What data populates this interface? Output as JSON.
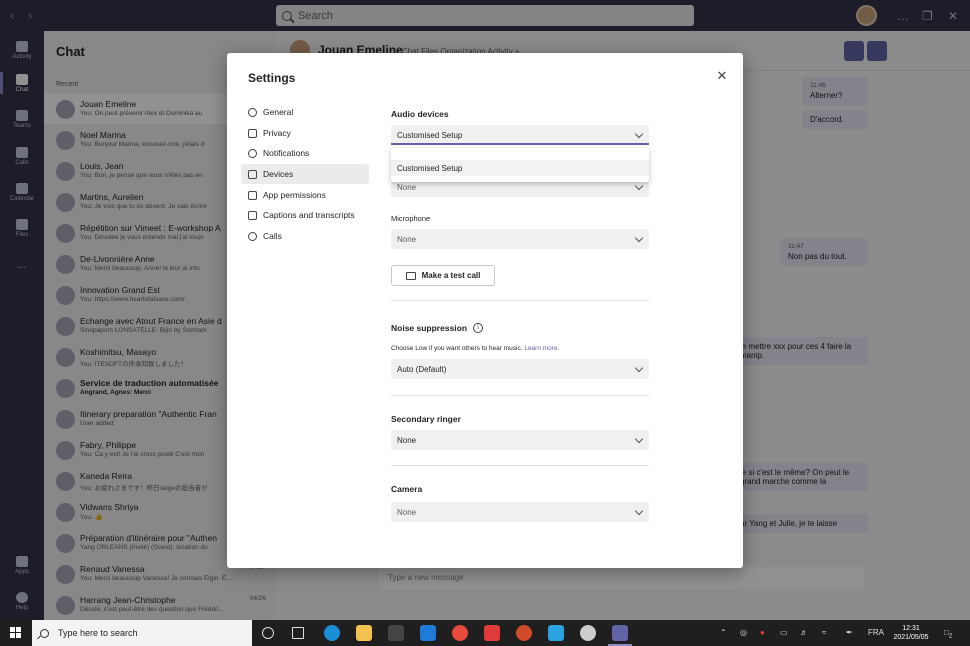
{
  "titlebar": {
    "search_placeholder": "Search"
  },
  "rail": {
    "items": [
      {
        "label": "Activity"
      },
      {
        "label": "Chat"
      },
      {
        "label": "Teams"
      },
      {
        "label": "Calls"
      },
      {
        "label": "Calendar"
      },
      {
        "label": "Files"
      },
      {
        "label": "..."
      },
      {
        "label": "Apps"
      },
      {
        "label": "Help"
      }
    ]
  },
  "chatlist": {
    "title": "Chat",
    "section": "Recent",
    "chats": [
      {
        "name": "Jouan Emeline",
        "preview": "You: On peut prévenir Alex et Dominika au",
        "date": ""
      },
      {
        "name": "Noel Marina",
        "preview": "You: Bonjour Marina, excusez-moi, j'étais d",
        "date": ""
      },
      {
        "name": "Louis, Jean",
        "preview": "You: Bon, je pense que vous n'êtes pas en",
        "date": ""
      },
      {
        "name": "Martins, Aurelien",
        "preview": "You: Je vois que tu es absent. Je vais écrire",
        "date": ""
      },
      {
        "name": "Répétition sur Vimeet : E-workshop A",
        "preview": "You: Désolée je vous entends mal j'ai toujo",
        "date": ""
      },
      {
        "name": "De-Livonnière Anne",
        "preview": "You: Merci beaucoup, Anne! le leur ai info",
        "date": ""
      },
      {
        "name": "Innovation Grand Est",
        "preview": "You: https://www.heartofalsace.com/",
        "date": ""
      },
      {
        "name": "Echange avec Atout France en Asie d",
        "preview": "Sinopapom LONSATELLE: Bijio by Somtam",
        "date": ""
      },
      {
        "name": "Koshimitsu, Masayo",
        "preview": "You: ITESOFTの件承知致しました！",
        "date": ""
      },
      {
        "name": "Service de traduction automatisée",
        "preview": "Angrand, Agnes: Merci",
        "date": ""
      },
      {
        "name": "Itinerary preparation \"Authentic Fran",
        "preview": "User added",
        "date": ""
      },
      {
        "name": "Fabry, Philippe",
        "preview": "You: Ca y est! Je l'ai cross posté C'est mon",
        "date": ""
      },
      {
        "name": "Kaneda Reira",
        "preview": "You: お疲れさまです！昨日siègeの担当者が",
        "date": ""
      },
      {
        "name": "Vidwans Shriya",
        "preview": "You: 👍",
        "date": ""
      },
      {
        "name": "Préparation d'itinéraire pour \"Authen",
        "preview": "Yang ORLEANS (Invité) (Guest): location du",
        "date": ""
      },
      {
        "name": "Renaud Vanessa",
        "preview": "You: Merci beaucoup Vanessa! Je connais Elgin. E...",
        "date": "04/27"
      },
      {
        "name": "Harrang Jean-Christophe",
        "preview": "Désolé, c'est peut-être des question que Frédéri...",
        "date": "04/26"
      }
    ]
  },
  "main": {
    "contact": "Jouan Emeline",
    "tabs": "Chat   Files   Organization   Activity   +",
    "messages": [
      {
        "time": "11:46",
        "text": "Alterner?"
      },
      {
        "time": "",
        "text": "D'accord."
      },
      {
        "time": "11:47",
        "text": "Non pas du tout."
      },
      {
        "time": "",
        "text": "le mettre xxx pour ces 4 faire la manip."
      },
      {
        "time": "",
        "text": "le si c'est le même? On peut le grand marche comme la"
      },
      {
        "time": "",
        "text": "ur Yang et Julie, je te laisse"
      }
    ],
    "composer_placeholder": "Type a new message"
  },
  "settings": {
    "title": "Settings",
    "close_label": "✕",
    "nav": [
      {
        "label": "General",
        "icon": "gear-icon"
      },
      {
        "label": "Privacy",
        "icon": "lock-icon"
      },
      {
        "label": "Notifications",
        "icon": "bell-icon"
      },
      {
        "label": "Devices",
        "icon": "devices-icon"
      },
      {
        "label": "App permissions",
        "icon": "apps-icon"
      },
      {
        "label": "Captions and transcripts",
        "icon": "captions-icon"
      },
      {
        "label": "Calls",
        "icon": "phone-icon"
      }
    ],
    "audio_devices": {
      "title": "Audio devices",
      "selected": "Customised Setup",
      "dropdown_option": "Customised Setup",
      "speaker_value": "None",
      "microphone_label": "Microphone",
      "microphone_value": "None",
      "test_call_label": "Make a test call"
    },
    "noise_suppression": {
      "title": "Noise suppression",
      "description": "Choose Low if you want others to hear music.",
      "learn_more": "Learn more.",
      "value": "Auto (Default)"
    },
    "secondary_ringer": {
      "title": "Secondary ringer",
      "value": "None"
    },
    "camera": {
      "title": "Camera",
      "value": "None"
    }
  },
  "taskbar": {
    "search_placeholder": "Type here to search",
    "language": "FRA",
    "time": "12:31",
    "date": "2021/05/05",
    "notifications_count": "2"
  },
  "colors": {
    "accent": "#6264a7",
    "titlebar": "#33344a",
    "taskbar": "#1f1f1f"
  }
}
